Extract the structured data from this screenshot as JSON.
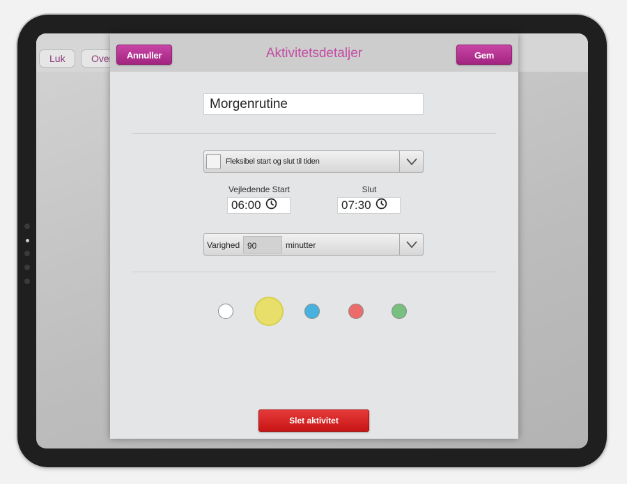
{
  "background_app": {
    "close_label": "Luk",
    "overview_label": "Overs"
  },
  "dialog": {
    "title": "Aktivitetsdetaljer",
    "cancel_label": "Annuller",
    "save_label": "Gem",
    "name_value": "Morgenrutine",
    "flexible_label": "Fleksibel start og slut til tiden",
    "flexible_checked": false,
    "start_label": "Vejledende Start",
    "start_time": "06:00",
    "end_label": "Slut",
    "end_time": "07:30",
    "duration_label": "Varighed",
    "duration_value": "90",
    "duration_unit": "minutter",
    "delete_label": "Slet aktivitet"
  },
  "colors": {
    "accent": "#b8308f",
    "title_color": "#c24aa3",
    "delete_red": "#d41f1f",
    "swatches": [
      {
        "name": "white",
        "hex": "#ffffff",
        "selected": false
      },
      {
        "name": "yellow",
        "hex": "#e8de6a",
        "selected": true
      },
      {
        "name": "blue",
        "hex": "#48b2df",
        "selected": false
      },
      {
        "name": "red",
        "hex": "#ec6b6b",
        "selected": false
      },
      {
        "name": "green",
        "hex": "#78c080",
        "selected": false
      }
    ]
  }
}
